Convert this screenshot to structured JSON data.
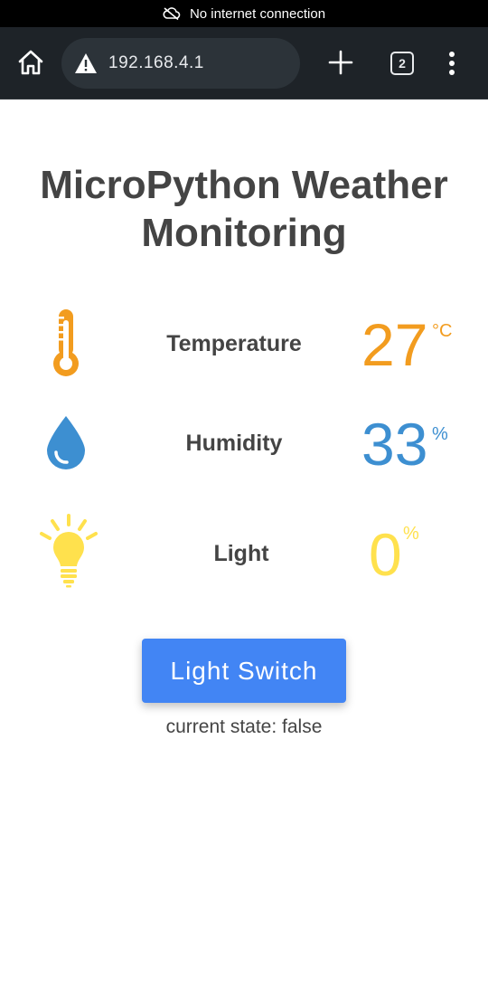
{
  "status_bar": {
    "text": "No internet connection"
  },
  "browser": {
    "url": "192.168.4.1",
    "tab_count": "2"
  },
  "page": {
    "title": "MicroPython Weather Monitoring",
    "sensors": [
      {
        "label": "Temperature",
        "value": "27",
        "unit": "°C",
        "color": "#f29c1f",
        "icon": "thermometer-icon"
      },
      {
        "label": "Humidity",
        "value": "33",
        "unit": "%",
        "color": "#3d8fd1",
        "icon": "water-drop-icon"
      },
      {
        "label": "Light",
        "value": "0",
        "unit": "%",
        "color": "#ffe14d",
        "icon": "light-bulb-icon"
      }
    ],
    "button_label": "Light Switch",
    "state_text": "current state: false"
  },
  "colors": {
    "button": "#4285f4",
    "text": "#444444",
    "toolbar": "#1e2328"
  }
}
